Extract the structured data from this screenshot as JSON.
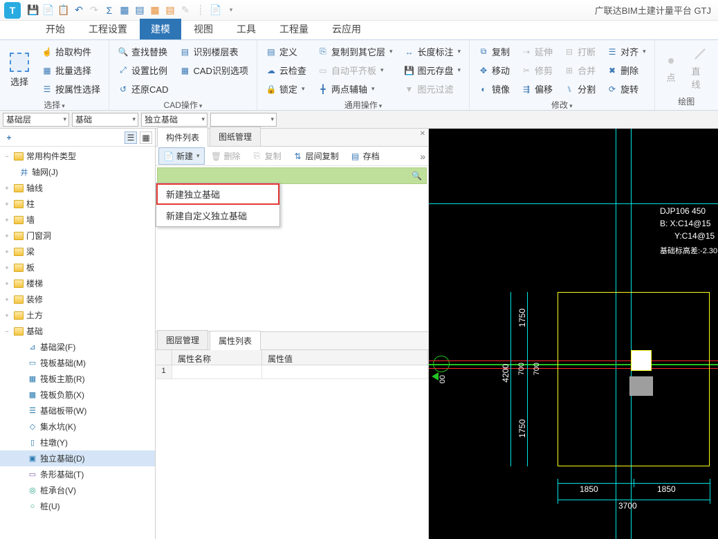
{
  "app_title": "广联达BIM土建计量平台 GTJ",
  "qat_icons": [
    "save",
    "copy",
    "paste",
    "undo",
    "redo",
    "sigma",
    "grid",
    "tab",
    "tab2",
    "tab3",
    "pencil",
    "dash",
    "newdoc"
  ],
  "menu_tabs": [
    "开始",
    "工程设置",
    "建模",
    "视图",
    "工具",
    "工程量",
    "云应用"
  ],
  "menu_active": 2,
  "ribbon": {
    "g1": {
      "select": "选择",
      "pick": "拾取构件",
      "batch": "批量选择",
      "byprop": "按属性选择",
      "label": "选择"
    },
    "g2": {
      "find": "查找替换",
      "layer": "识别楼层表",
      "scale": "设置比例",
      "cad": "CAD识别选项",
      "restore": "还原CAD",
      "label": "CAD操作"
    },
    "g3": {
      "def": "定义",
      "cloud": "云检查",
      "lock": "锁定",
      "copyto": "复制到其它层",
      "auto": "自动平齐板",
      "twopt": "两点辅轴",
      "len": "长度标注",
      "save": "图元存盘",
      "filter": "图元过滤",
      "label": "通用操作"
    },
    "g4": {
      "copy": "复制",
      "move": "移动",
      "mirror": "镜像",
      "extend": "延伸",
      "trim": "修剪",
      "offset": "偏移",
      "break": "打断",
      "merge": "合并",
      "split": "分割",
      "align": "对齐",
      "delete": "删除",
      "rotate": "旋转",
      "label": "修改"
    },
    "g5": {
      "point": "点",
      "line": "直线",
      "label": "绘图"
    }
  },
  "selectors": {
    "layer": "基础层",
    "cat": "基础",
    "type": "独立基础",
    "name": ""
  },
  "left_tools": {
    "plus": "+"
  },
  "tree": {
    "root": "常用构件类型",
    "axis": "轴网(J)",
    "folders": [
      "轴线",
      "柱",
      "墙",
      "门窗洞",
      "梁",
      "板",
      "楼梯",
      "装修",
      "土方"
    ],
    "base": "基础",
    "base_children": [
      {
        "label": "基础梁(F)",
        "c": "#2a7ab0"
      },
      {
        "label": "筏板基础(M)",
        "c": "#2a7ab0"
      },
      {
        "label": "筏板主筋(R)",
        "c": "#2a7ab0"
      },
      {
        "label": "筏板负筋(X)",
        "c": "#2a7ab0"
      },
      {
        "label": "基础板带(W)",
        "c": "#2a7ab0"
      },
      {
        "label": "集水坑(K)",
        "c": "#2a7ab0"
      },
      {
        "label": "柱墩(Y)",
        "c": "#2a7ab0"
      },
      {
        "label": "独立基础(D)",
        "c": "#2a7ab0",
        "sel": true
      },
      {
        "label": "条形基础(T)",
        "c": "#7a5ab0"
      },
      {
        "label": "桩承台(V)",
        "c": "#20a080"
      },
      {
        "label": "桩(U)",
        "c": "#20a080"
      }
    ]
  },
  "mid": {
    "tabs": [
      "构件列表",
      "图纸管理"
    ],
    "toolbar": {
      "new": "新建",
      "del": "删除",
      "copy": "复制",
      "layerCopy": "层间复制",
      "archive": "存档"
    },
    "dropdown": [
      "新建独立基础",
      "新建自定义独立基础"
    ],
    "bottom_tabs": [
      "图层管理",
      "属性列表"
    ],
    "prop_headers": [
      "属性名称",
      "属性值"
    ],
    "row1": "1"
  },
  "canvas": {
    "labels": {
      "a": "DJP106 450",
      "b": "B: X:C14@15",
      "c": "Y:C14@15",
      "d": "基础标高差:-2.30"
    },
    "dims": {
      "d1750a": "1750",
      "d4200": "4200",
      "d700a": "700",
      "d700b": "700",
      "d1750b": "1750",
      "d1850a": "1850",
      "d1850b": "1850",
      "d3700": "3700",
      "d00": "00"
    }
  }
}
